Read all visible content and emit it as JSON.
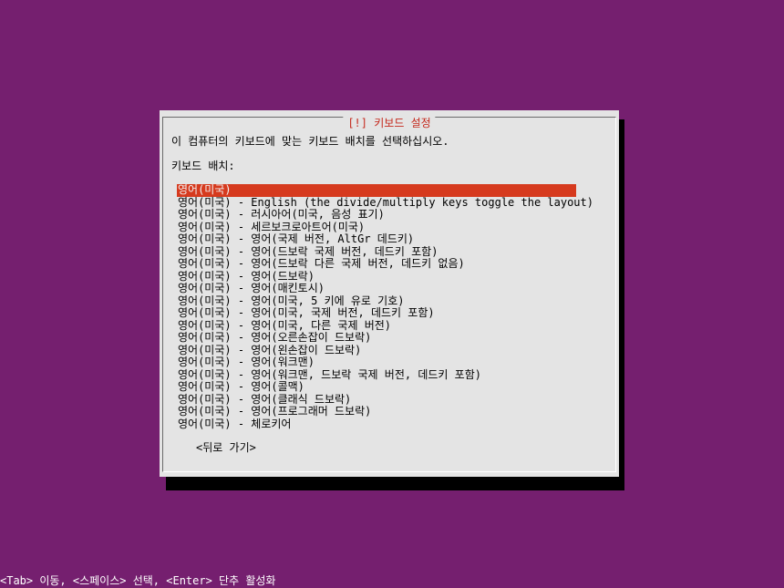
{
  "dialog": {
    "title": "[!] 키보드 설정",
    "prompt": "이 컴퓨터의 키보드에 맞는 키보드 배치를 선택하십시오.",
    "list_label": "키보드 배치:",
    "options": [
      "영어(미국)",
      "영어(미국) - English (the divide/multiply keys toggle the layout)",
      "영어(미국) - 러시아어(미국, 음성 표기)",
      "영어(미국) - 세르보크로아트어(미국)",
      "영어(미국) - 영어(국제 버전, AltGr 데드키)",
      "영어(미국) - 영어(드보락 국제 버전, 데드키 포함)",
      "영어(미국) - 영어(드보락 다른 국제 버전, 데드키 없음)",
      "영어(미국) - 영어(드보락)",
      "영어(미국) - 영어(매킨토시)",
      "영어(미국) - 영어(미국, 5 키에 유로 기호)",
      "영어(미국) - 영어(미국, 국제 버전, 데드키 포함)",
      "영어(미국) - 영어(미국, 다른 국제 버전)",
      "영어(미국) - 영어(오른손잡이 드보락)",
      "영어(미국) - 영어(왼손잡이 드보락)",
      "영어(미국) - 영어(워크맨)",
      "영어(미국) - 영어(워크맨, 드보락 국제 버전, 데드키 포함)",
      "영어(미국) - 영어(콜맥)",
      "영어(미국) - 영어(클래식 드보락)",
      "영어(미국) - 영어(프로그래머 드보락)",
      "영어(미국) - 체로키어"
    ],
    "selected_index": 0,
    "back_button": "<뒤로 가기>"
  },
  "statusbar": {
    "text": "<Tab> 이동, <스페이스> 선택, <Enter> 단추 활성화"
  },
  "colors": {
    "background": "#751f6f",
    "dialog": "#e4e4e4",
    "title": "#c4281c",
    "selection": "#d63a1e"
  }
}
